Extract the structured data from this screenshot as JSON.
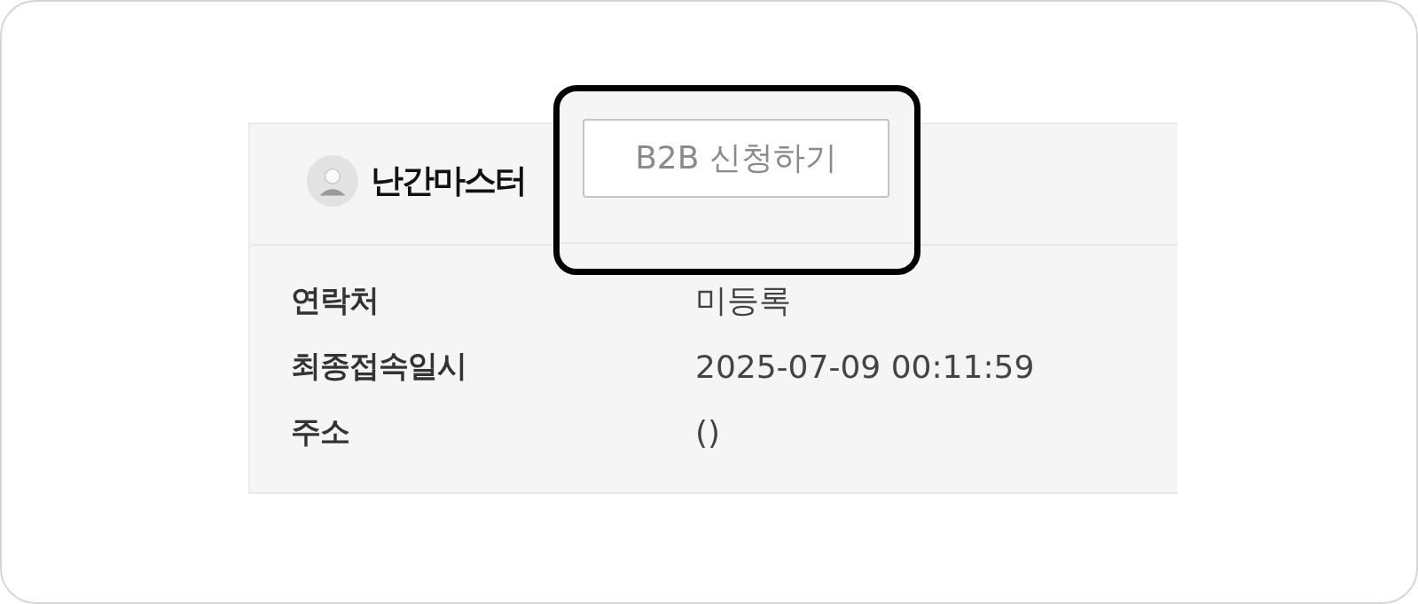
{
  "profile": {
    "name": "난간마스터",
    "button": "B2B 신청하기"
  },
  "fields": [
    {
      "label": "연락처",
      "value": "미등록"
    },
    {
      "label": "최종접속일시",
      "value": "2025-07-09 00:11:59"
    },
    {
      "label": "주소",
      "value": "()"
    }
  ]
}
